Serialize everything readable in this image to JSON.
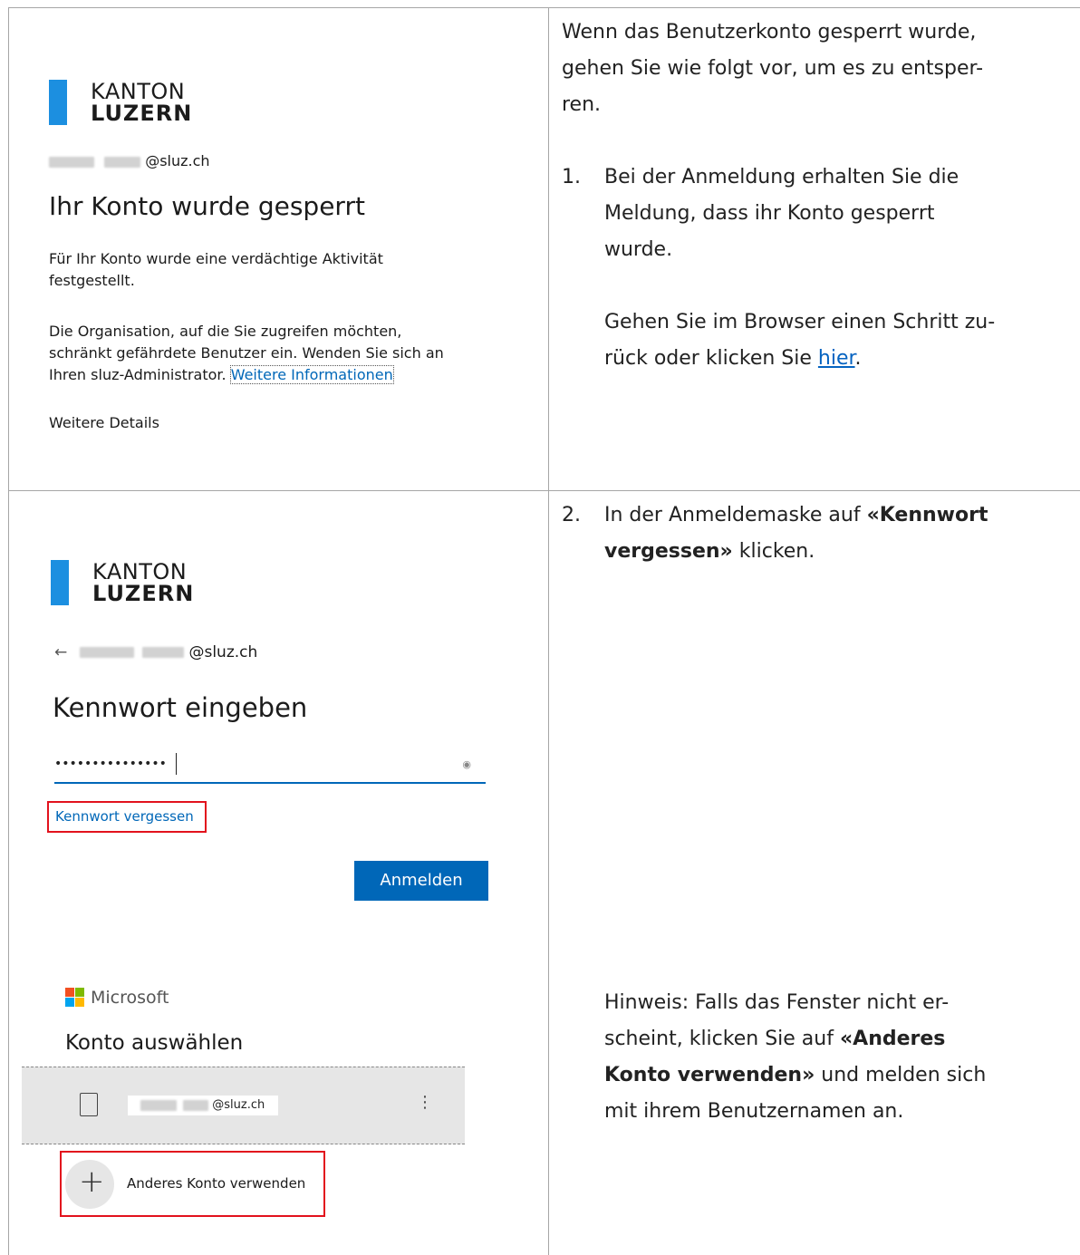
{
  "row1": {
    "logo": {
      "line1": "KANTON",
      "line2": "LUZERN"
    },
    "email_suffix": "@sluz.ch",
    "heading": "Ihr Konto wurde gesperrt",
    "para1_line1": "Für Ihr Konto wurde eine verdächtige Aktivität",
    "para1_line2": "festgestellt.",
    "para2_line1": "Die Organisation, auf die Sie zugreifen möchten,",
    "para2_line2": "schränkt gefährdete Benutzer ein. Wenden Sie sich an",
    "para2_line3_prefix": "Ihren sluz-Administrator.",
    "para2_link": "Weitere Informationen",
    "details_link": "Weitere Details",
    "right": {
      "intro_l1": "Wenn das Benutzerkonto gesperrt wurde,",
      "intro_l2": "gehen Sie wie folgt vor, um es zu entsper-",
      "intro_l3": "ren.",
      "step_num": "1.",
      "step_l1": "Bei der Anmeldung erhalten Sie die",
      "step_l2": "Meldung, dass ihr Konto gesperrt",
      "step_l3": "wurde.",
      "back_l1": "Gehen Sie im Browser einen Schritt zu-",
      "back_l2_prefix": "rück oder klicken Sie ",
      "back_link": "hier",
      "back_l2_suffix": "."
    }
  },
  "row2": {
    "logo": {
      "line1": "KANTON",
      "line2": "LUZERN"
    },
    "back_arrow": "←",
    "email_suffix": "@sluz.ch",
    "heading": "Kennwort eingeben",
    "password_dots": "•••••••••••••••",
    "forgot_link": "Kennwort vergessen",
    "signin_button": "Anmelden",
    "ms_brand": "Microsoft",
    "choose_heading": "Konto auswählen",
    "account_email_suffix": "@sluz.ch",
    "kebab": "⋮",
    "other_account_plus": "+",
    "other_account_label": "Anderes Konto verwenden",
    "right": {
      "step_num": "2.",
      "step_l1_prefix": "In der Anmeldemaske auf ",
      "step_l1_bold": "«Kennwort",
      "step_l2_bold": "vergessen»",
      "step_l2_suffix": " klicken.",
      "hint_l1": "Hinweis: Falls das Fenster nicht er-",
      "hint_l2_prefix": "scheint, klicken Sie auf ",
      "hint_l2_bold": "«Anderes",
      "hint_l3_bold": "Konto verwenden»",
      "hint_l3_suffix": " und melden sich",
      "hint_l4": "mit ihrem Benutzernamen an."
    }
  },
  "colors": {
    "link": "#0067b8",
    "logo_bar": "#1c8fe0",
    "highlight_box": "#e2121d",
    "button": "#0067b8",
    "ms_red": "#f25022",
    "ms_green": "#7fba00",
    "ms_blue": "#00a4ef",
    "ms_yellow": "#ffb900"
  }
}
